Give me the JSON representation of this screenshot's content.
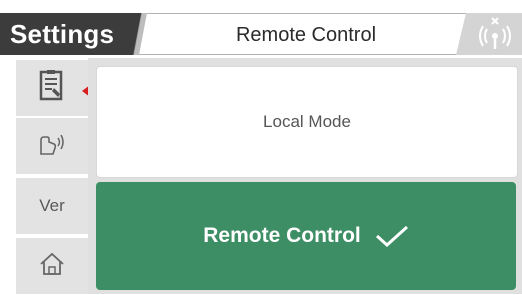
{
  "header": {
    "section_title": "Settings",
    "page_title": "Remote Control",
    "icons": {
      "signal": "antenna-signal-icon"
    }
  },
  "sidebar": {
    "items": [
      {
        "icon": "clipboard-tools-icon",
        "label": "",
        "active": true
      },
      {
        "icon": "hand-swipe-icon",
        "label": ""
      },
      {
        "icon": "",
        "label": "Ver"
      },
      {
        "icon": "home-icon",
        "label": ""
      }
    ]
  },
  "modes": {
    "local_label": "Local Mode",
    "remote_label": "Remote Control",
    "selected": "remote"
  },
  "colors": {
    "header_dark": "#3c3c3c",
    "selected_green": "#3e8e65",
    "pointer_red": "#d81e1e",
    "panel_gray": "#e0e0e0"
  }
}
